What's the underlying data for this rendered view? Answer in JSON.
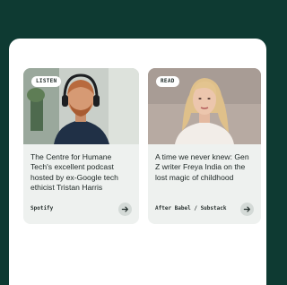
{
  "colors": {
    "background": "#0e3a32",
    "panel": "#ffffff",
    "card": "#eef1ef",
    "arrow_button": "#d4dad7"
  },
  "cards": [
    {
      "badge": "LISTEN",
      "title": "The Centre for Humane Tech's excellent podcast hosted by ex-Google tech ethicist Tristan Harris",
      "source": "Spotify",
      "image": "man-with-headphones-photo",
      "icon": "arrow-right-icon"
    },
    {
      "badge": "READ",
      "title": "A time we never knew: Gen Z writer Freya India on the lost magic of childhood",
      "source": "After Babel / Substack",
      "image": "blonde-woman-photo",
      "icon": "arrow-right-icon"
    }
  ]
}
